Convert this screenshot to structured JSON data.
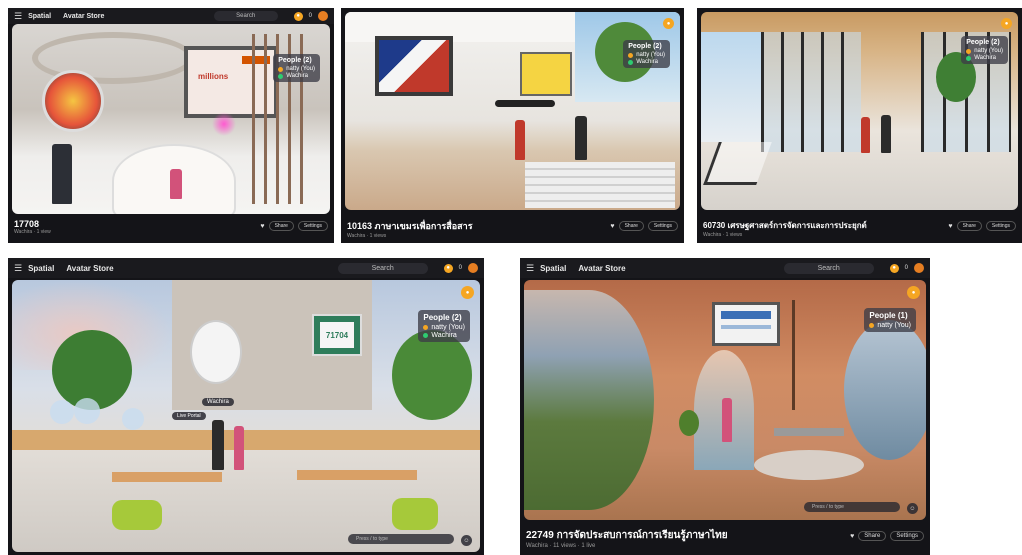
{
  "app": {
    "brand": "Spatial",
    "store": "Avatar Store",
    "search_placeholder": "Search"
  },
  "accent": "#f5a623",
  "shots": [
    {
      "title": "17708",
      "subtitle": "Wachira · 1 view",
      "share": "Share",
      "settings": "Settings",
      "people_header": "People (2)",
      "people": [
        "natty (You)",
        "Wachira"
      ],
      "coins": "0",
      "poster_caption": "millions"
    },
    {
      "title": "10163 ภาษาเขมรเพื่อการสื่อสาร",
      "subtitle": "Wachira · 1 views",
      "share": "Share",
      "settings": "Settings",
      "people_header": "People (2)",
      "people": [
        "natty (You)",
        "Wachira"
      ],
      "coins": "0"
    },
    {
      "title": "60730 เศรษฐศาสตร์การจัดการและการประยุกต์",
      "subtitle": "Wachira · 1 views",
      "share": "Share",
      "settings": "Settings",
      "people_header": "People (2)",
      "people": [
        "natty (You)",
        "Wachira"
      ],
      "coins": "0"
    },
    {
      "people_header": "People (2)",
      "people": [
        "natty (You)",
        "Wachira"
      ],
      "coins": "0",
      "board_number": "71704",
      "name_tag": "Wachira",
      "portal_label": "Live Portal",
      "chat_placeholder": "Press / to type"
    },
    {
      "title": "22749 การจัดประสบการณ์การเรียนรู้ภาษาไทย",
      "subtitle": "Wachira · 11 views · 1 live",
      "share": "Share",
      "settings": "Settings",
      "people_header": "People (1)",
      "people": [
        "natty (You)"
      ],
      "coins": "0",
      "chat_placeholder": "Press / to type"
    }
  ]
}
